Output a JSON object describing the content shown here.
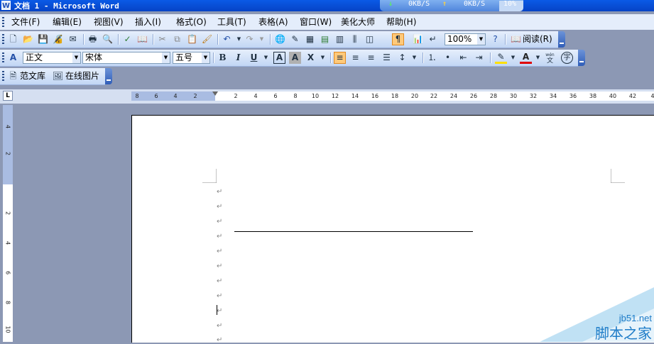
{
  "titlebar": {
    "app_icon": "W",
    "title": "文档 1 - Microsoft Word"
  },
  "netmon": {
    "down": "0KB/S",
    "up": "0KB/S",
    "cpu": "10%"
  },
  "menu": [
    "文件(F)",
    "编辑(E)",
    "视图(V)",
    "插入(I)",
    "格式(O)",
    "工具(T)",
    "表格(A)",
    "窗口(W)",
    "美化大师",
    "帮助(H)"
  ],
  "standard": {
    "zoom": "100%",
    "read_label": "阅读(R)"
  },
  "formatting": {
    "style": "正文",
    "font": "宋体",
    "size": "五号",
    "bold": "B",
    "italic": "I",
    "underline": "U",
    "border_char": "A",
    "shade_char": "A",
    "scale_char": "文",
    "wen_char": "wén",
    "char_circle": "字",
    "font_color": "A"
  },
  "extras": {
    "fanwenku": "范文库",
    "online_pic": "在线图片"
  },
  "ruler": {
    "h_numbers": [
      "8",
      "6",
      "4",
      "2",
      "2",
      "4",
      "6",
      "8",
      "10",
      "12",
      "14",
      "16",
      "18",
      "20",
      "22",
      "24",
      "26",
      "28",
      "30",
      "32",
      "34",
      "36",
      "38",
      "40",
      "42",
      "4"
    ],
    "v_numbers": [
      "4",
      "2",
      "2",
      "4",
      "6",
      "8",
      "10"
    ]
  },
  "watermark": {
    "site": "jb51.net",
    "name": "脚本之家"
  },
  "colors": {
    "title": "#0A5AE6",
    "toolbar": "#C2D6F4",
    "workspace": "#8C98B4"
  }
}
